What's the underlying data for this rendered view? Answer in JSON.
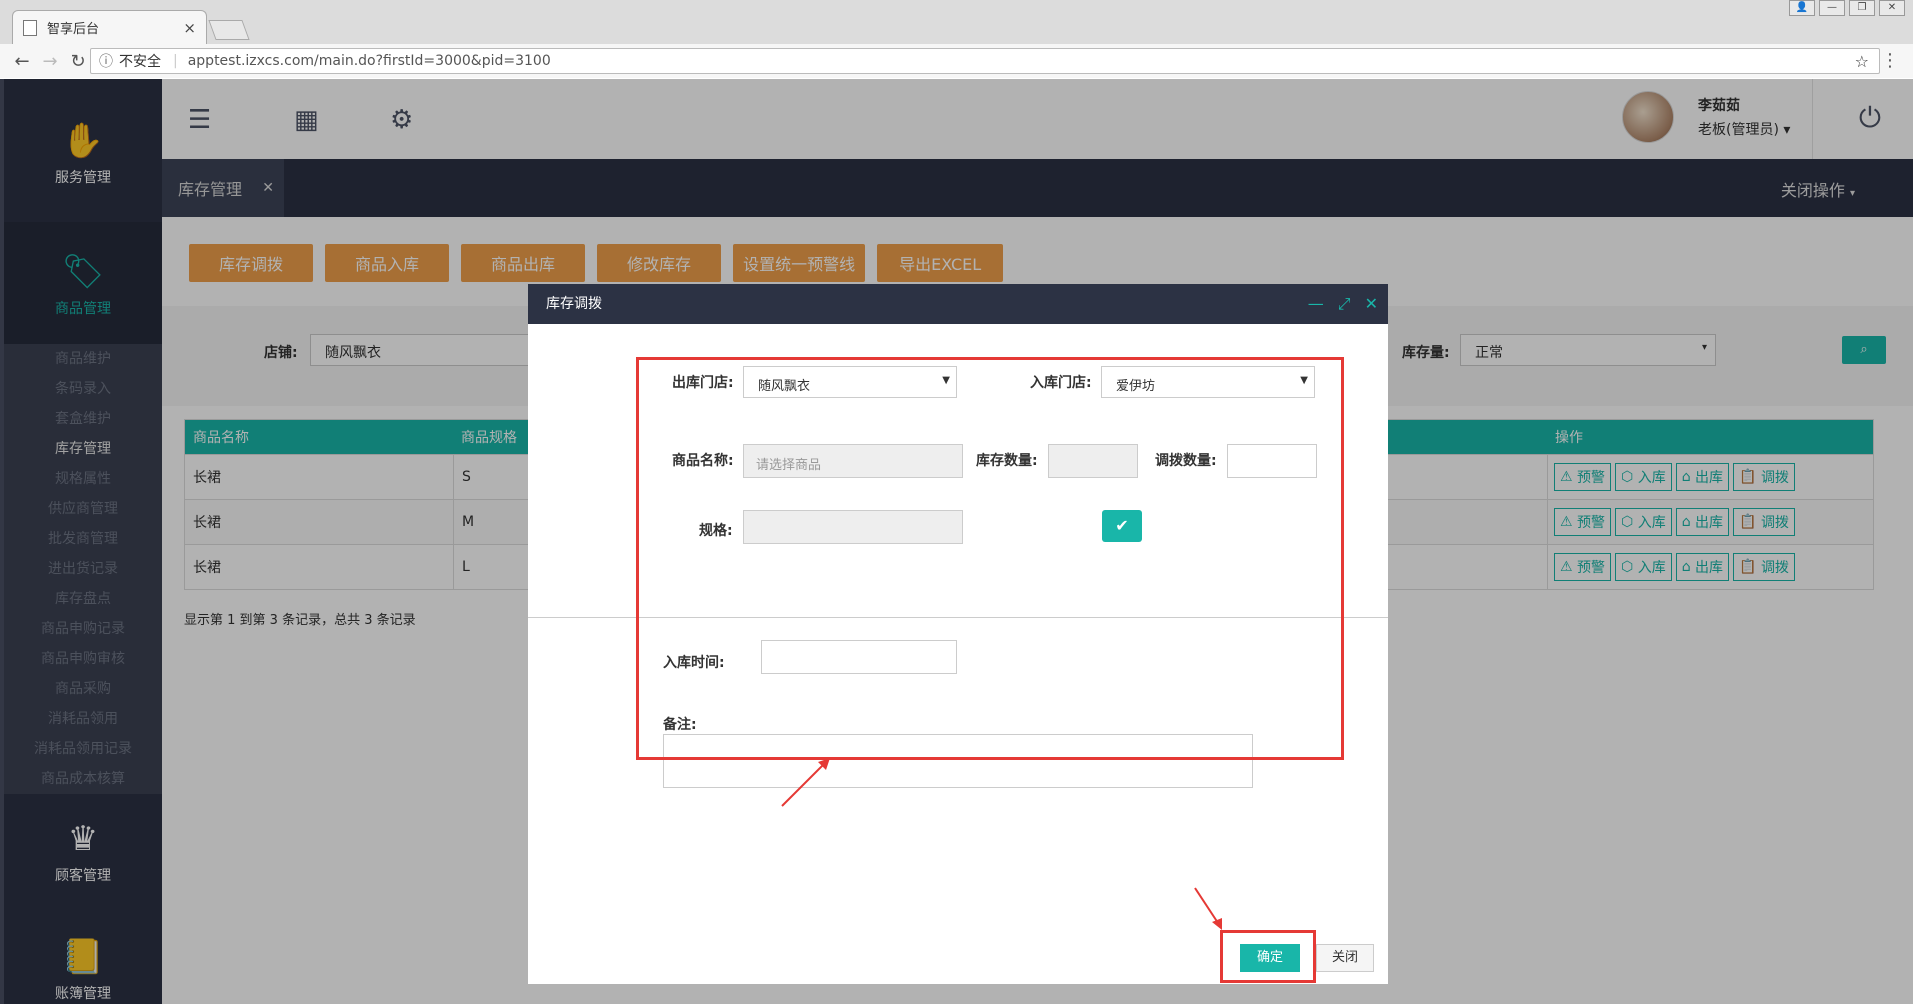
{
  "browser": {
    "tab_title": "智享后台",
    "security": "不安全",
    "url": "apptest.izxcs.com/main.do?firstId=3000&pid=3100"
  },
  "sidebar": {
    "service": "服务管理",
    "goods": "商品管理",
    "customer": "顾客管理",
    "account": "账簿管理",
    "submenu": [
      "商品维护",
      "条码录入",
      "套盒维护",
      "库存管理",
      "规格属性",
      "供应商管理",
      "批发商管理",
      "进出货记录",
      "库存盘点",
      "商品申购记录",
      "商品申购审核",
      "商品采购",
      "消耗品领用",
      "消耗品领用记录",
      "商品成本核算"
    ]
  },
  "user": {
    "name": "李茹茹",
    "role": "老板(管理员)"
  },
  "tabs": {
    "current": "库存管理",
    "close_ops": "关闭操作"
  },
  "actions": [
    "库存调拨",
    "商品入库",
    "商品出库",
    "修改库存",
    "设置统一预警线",
    "导出EXCEL"
  ],
  "filter": {
    "store_label": "店铺:",
    "store_value": "随风飘衣",
    "stock_label": "库存量:",
    "stock_value": "正常"
  },
  "table": {
    "headers": [
      "商品名称",
      "商品规格",
      "操作"
    ],
    "rows": [
      {
        "name": "长裙",
        "spec": "S"
      },
      {
        "name": "长裙",
        "spec": "M"
      },
      {
        "name": "长裙",
        "spec": "L"
      }
    ],
    "ops": [
      "预警",
      "入库",
      "出库",
      "调拨"
    ],
    "pager": "显示第 1 到第 3 条记录，总共 3 条记录"
  },
  "modal": {
    "title": "库存调拨",
    "out_store_label": "出库门店:",
    "out_store_value": "随风飘衣",
    "in_store_label": "入库门店:",
    "in_store_value": "爱伊坊",
    "goods_label": "商品名称:",
    "goods_placeholder": "请选择商品",
    "stock_qty_label": "库存数量:",
    "transfer_qty_label": "调拨数量:",
    "spec_label": "规格:",
    "in_time_label": "入库时间:",
    "note_label": "备注:",
    "ok": "确定",
    "close": "关闭"
  },
  "colors": {
    "accent": "#19b6a9",
    "orange": "#f0a04b",
    "dark": "#2c3244",
    "annotation": "#e53935"
  }
}
